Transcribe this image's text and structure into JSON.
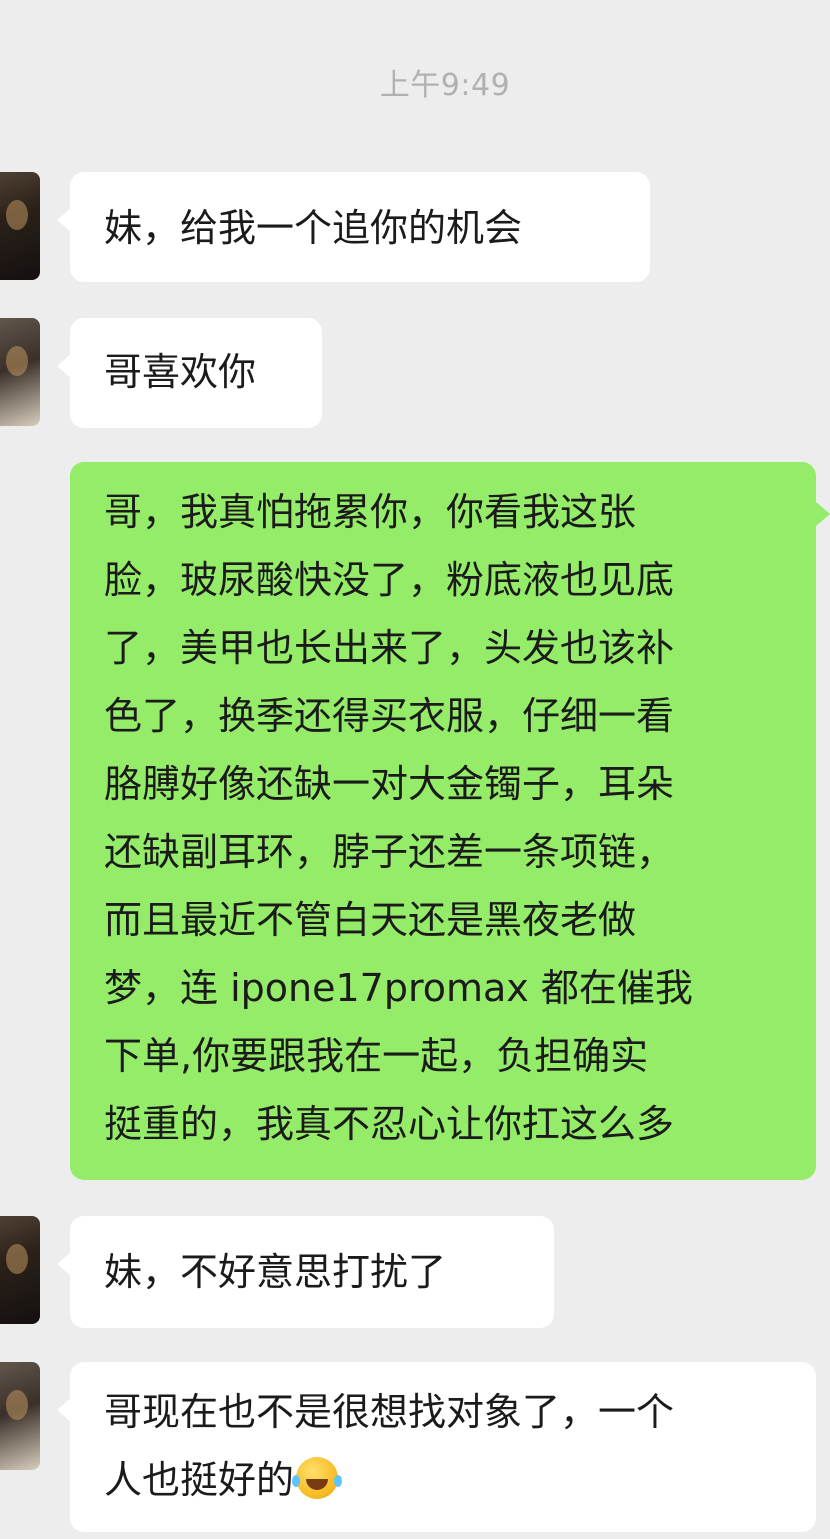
{
  "chat": {
    "timestamp": "上午9:49",
    "messages": [
      {
        "sender": "other",
        "lines": [
          "妹，给我一个追你的机会"
        ]
      },
      {
        "sender": "other",
        "lines": [
          "哥喜欢你"
        ]
      },
      {
        "sender": "self",
        "lines": [
          "哥，我真怕拖累你，你看我这张",
          "脸，玻尿酸快没了，粉底液也见底",
          "了，美甲也长出来了，头发也该补",
          "色了，换季还得买衣服，仔细一看",
          "胳膊好像还缺一对大金镯子，耳朵",
          "还缺副耳环，脖子还差一条项链，",
          "而且最近不管白天还是黑夜老做",
          "梦，连 ipone17promax 都在催我",
          "下单,你要跟我在一起，负担确实",
          "挺重的，我真不忍心让你扛这么多"
        ]
      },
      {
        "sender": "other",
        "lines": [
          "妹，不好意思打扰了"
        ]
      },
      {
        "sender": "other",
        "lines": [
          "哥现在也不是很想找对象了，一个",
          "人也挺好的"
        ],
        "emoji": "laughing-tears-emoji"
      }
    ]
  }
}
